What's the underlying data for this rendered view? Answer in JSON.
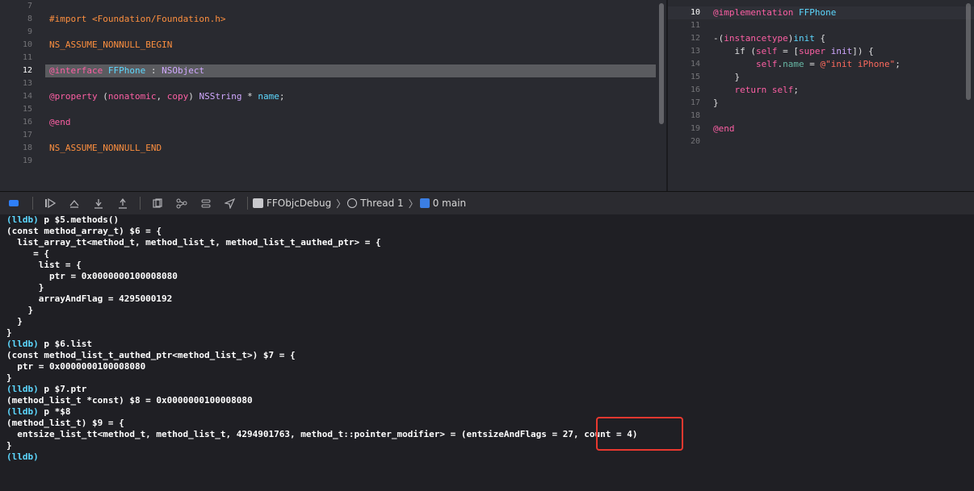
{
  "left_editor": {
    "lines": [
      {
        "num": "7",
        "text": ""
      },
      {
        "num": "8",
        "text": "#import <Foundation/Foundation.h>"
      },
      {
        "num": "9",
        "text": ""
      },
      {
        "num": "10",
        "text": "NS_ASSUME_NONNULL_BEGIN"
      },
      {
        "num": "11",
        "text": ""
      },
      {
        "num": "12",
        "text": ""
      },
      {
        "num": "13",
        "text": ""
      },
      {
        "num": "14",
        "text": ""
      },
      {
        "num": "15",
        "text": ""
      },
      {
        "num": "16",
        "text": "@end"
      },
      {
        "num": "17",
        "text": ""
      },
      {
        "num": "18",
        "text": "NS_ASSUME_NONNULL_END"
      },
      {
        "num": "19",
        "text": ""
      }
    ],
    "line12": {
      "kw": "@interface",
      "cls": "FFPhone",
      "colon": " : ",
      "super": "NSObject"
    },
    "line14": {
      "kw": "@property",
      "open": " (",
      "a1": "nonatomic",
      "comma": ", ",
      "a2": "copy",
      "close": ") ",
      "type": "NSString",
      "star": " * ",
      "name": "name",
      "semi": ";"
    }
  },
  "right_editor": {
    "nums": [
      "10",
      "11",
      "12",
      "13",
      "14",
      "15",
      "16",
      "17",
      "18",
      "19",
      "20"
    ],
    "impl_kw": "@implementation",
    "impl_cls": "FFPhone",
    "l12_a": "-(",
    "l12_b": "instancetype",
    "l12_c": ")",
    "l12_d": "init",
    "l12_e": " {",
    "l13_a": "    if (",
    "l13_b": "self",
    "l13_c": " = [",
    "l13_d": "super",
    "l13_e": " ",
    "l13_f": "init",
    "l13_g": "]) {",
    "l14_a": "        self",
    "l14_b": ".",
    "l14_c": "name",
    "l14_d": " = ",
    "l14_e": "@\"init iPhone\"",
    "l14_f": ";",
    "l15": "    }",
    "l16_a": "    return ",
    "l16_b": "self",
    "l16_c": ";",
    "l17": "}",
    "l19": "@end"
  },
  "debug_bar": {
    "target": "FFObjcDebug",
    "thread": "Thread 1",
    "frame": "0 main"
  },
  "console": {
    "lines": [
      "(lldb) p $5.methods()",
      "(const method_array_t) $6 = {",
      "  list_array_tt<method_t, method_list_t, method_list_t_authed_ptr> = {",
      "     = {",
      "      list = {",
      "        ptr = 0x0000000100008080",
      "      }",
      "      arrayAndFlag = 4295000192",
      "    }",
      "  }",
      "}",
      "(lldb) p $6.list",
      "(const method_list_t_authed_ptr<method_list_t>) $7 = {",
      "  ptr = 0x0000000100008080",
      "}",
      "(lldb) p $7.ptr",
      "(method_list_t *const) $8 = 0x0000000100008080",
      "(lldb) p *$8",
      "(method_list_t) $9 = {",
      "  entsize_list_tt<method_t, method_list_t, 4294901763, method_t::pointer_modifier> = (entsizeAndFlags = 27, count = 4)",
      "}",
      "(lldb) "
    ]
  },
  "colors": {
    "highlight_border": "#e8382f",
    "keyword": "#fc5fa3",
    "type": "#5dd8ff"
  }
}
